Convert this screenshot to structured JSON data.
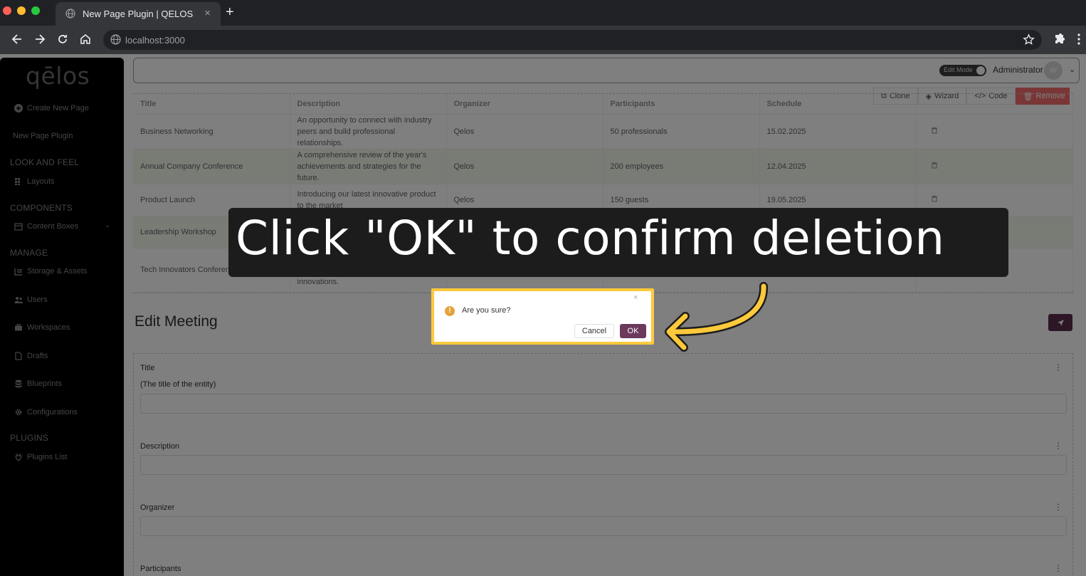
{
  "browser": {
    "tab_title": "New Page Plugin | QELOS",
    "url": "localhost:3000"
  },
  "sidebar": {
    "logo": "qēlos",
    "create_new_page": "Create New Page",
    "new_page_plugin": "New Page Plugin",
    "sections": {
      "look_and_feel": "LOOK AND FEEL",
      "components": "COMPONENTS",
      "manage": "MANAGE",
      "plugins": "PLUGINS"
    },
    "items": {
      "layouts": "Layouts",
      "content_boxes": "Content Boxes",
      "storage": "Storage & Assets",
      "users": "Users",
      "workspaces": "Workspaces",
      "drafts": "Drafts",
      "blueprints": "Blueprints",
      "configurations": "Configurations",
      "plugins_list": "Plugins List"
    }
  },
  "header": {
    "edit_mode": "Edit Mode",
    "user": "Administrator",
    "avatar_initial": "W"
  },
  "actions": {
    "clone": "Clone",
    "wizard": "Wizard",
    "code": "Code",
    "remove": "Remove"
  },
  "table": {
    "columns": [
      "Title",
      "Description",
      "Organizer",
      "Participants",
      "Schedule"
    ],
    "rows": [
      {
        "title": "Business Networking",
        "description": "An opportunity to connect with industry peers and build professional relationships.",
        "organizer": "Qelos",
        "participants": "50 professionals",
        "schedule": "15.02.2025"
      },
      {
        "title": "Annual Company Conference",
        "description": "A comprehensive review of the year's achievements and strategies for the future.",
        "organizer": "Qelos",
        "participants": "200 employees",
        "schedule": "12.04.2025"
      },
      {
        "title": "Product Launch",
        "description": "Introducing our latest innovative product to the market",
        "organizer": "Qelos",
        "participants": "150 guests",
        "schedule": "19.05.2025"
      },
      {
        "title": "Leadership Workshop",
        "description": "",
        "organizer": "",
        "participants": "",
        "schedule": ""
      },
      {
        "title": "Tech Innovators Conference",
        "description": "innovations.",
        "organizer": "",
        "participants": "",
        "schedule": ""
      }
    ]
  },
  "form": {
    "heading": "Edit Meeting",
    "title_label": "Title",
    "title_hint": "(The title of the entity)",
    "description_label": "Description",
    "organizer_label": "Organizer",
    "participants_label": "Participants"
  },
  "callout": {
    "text": "Click \"OK\" to confirm deletion"
  },
  "dialog": {
    "message": "Are you sure?",
    "cancel": "Cancel",
    "ok": "OK",
    "warning_glyph": "!",
    "close_glyph": "×"
  },
  "colors": {
    "highlight": "#ffc93c",
    "primary": "#6b3a5c",
    "remove": "#f56c6c"
  }
}
